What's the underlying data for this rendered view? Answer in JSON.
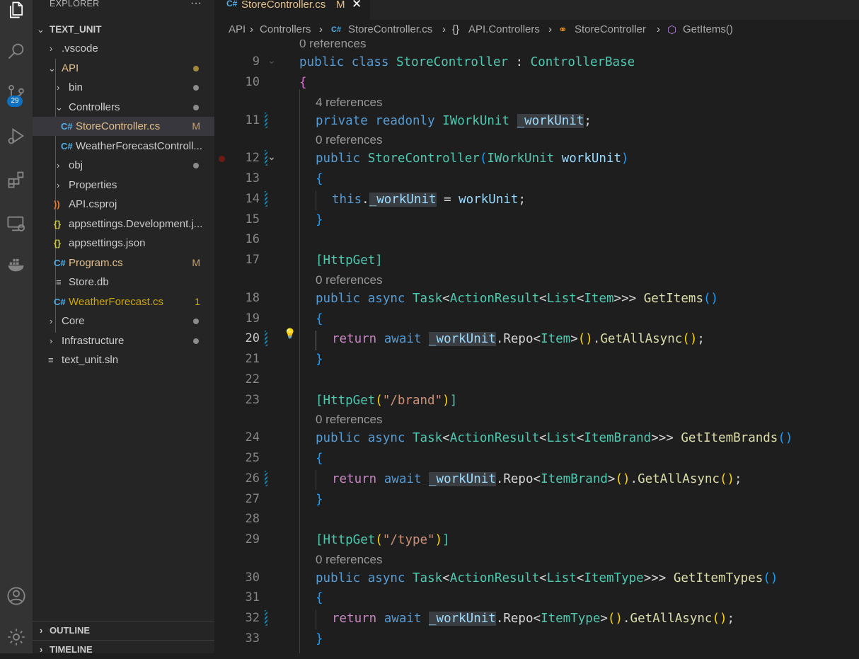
{
  "activity": {
    "badge": "29"
  },
  "explorer": {
    "header": "EXPLORER",
    "more": "···",
    "root": "TEXT_UNIT",
    "items": [
      {
        "label": ".vscode"
      },
      {
        "label": "API"
      },
      {
        "label": "bin"
      },
      {
        "label": "Controllers"
      },
      {
        "label": "StoreController.cs",
        "status": "M"
      },
      {
        "label": "WeatherForecastControll..."
      },
      {
        "label": "obj"
      },
      {
        "label": "Properties"
      },
      {
        "label": "API.csproj"
      },
      {
        "label": "appsettings.Development.j..."
      },
      {
        "label": "appsettings.json"
      },
      {
        "label": "Program.cs",
        "status": "M"
      },
      {
        "label": "Store.db"
      },
      {
        "label": "WeatherForecast.cs",
        "status": "1"
      },
      {
        "label": "Core"
      },
      {
        "label": "Infrastructure"
      },
      {
        "label": "text_unit.sln"
      }
    ],
    "outline": "OUTLINE",
    "timeline": "TIMELINE"
  },
  "tab": {
    "filename": "StoreController.cs",
    "status": "M",
    "close": "✕"
  },
  "breadcrumbs": [
    "API",
    "Controllers",
    "StoreController.cs",
    "API.Controllers",
    "StoreController",
    "GetItems()"
  ],
  "codelens": {
    "top": "0 references",
    "l11": "4 references",
    "l12": "0 references",
    "l18": "0 references",
    "l24": "0 references",
    "l30": "0 references"
  },
  "code": {
    "l9": {
      "public": "public",
      "class": "class",
      "name": "StoreController",
      "colon": " : ",
      "base": "ControllerBase"
    },
    "l10": "{",
    "l11": {
      "private": "private",
      "readonly": "readonly",
      "type": "IWorkUnit",
      "field": "_workUnit",
      "semi": ";"
    },
    "l12": {
      "public": "public",
      "name": "StoreController",
      "open": "(",
      "type": "IWorkUnit",
      "param": "workUnit",
      "close": ")"
    },
    "l13": "{",
    "l14": {
      "this": "this",
      "dot": ".",
      "field": "_workUnit",
      "assign": " = ",
      "val": "workUnit",
      "semi": ";"
    },
    "l15": "}",
    "l17": {
      "attr": "[HttpGet]"
    },
    "l18": {
      "public": "public",
      "async": "async",
      "task": "Task",
      "lt1": "<",
      "ar": "ActionResult",
      "lt2": "<",
      "list": "List",
      "lt3": "<",
      "item": "Item",
      "gt": ">>>",
      "method": "GetItems",
      "parens": "()"
    },
    "l19": "{",
    "l20": {
      "return": "return",
      "await": "await",
      "field": "_workUnit",
      "repo": ".Repo",
      "lt": "<",
      "type": "Item",
      "gt": ">",
      "call": "()",
      "dot": ".",
      "m": "GetAllAsync",
      "args": "()",
      "semi": ";"
    },
    "l21": "}",
    "l23": {
      "open": "[HttpGet",
      "p1": "(",
      "str": "\"/brand\"",
      "p2": ")",
      "close": "]"
    },
    "l24": {
      "public": "public",
      "async": "async",
      "task": "Task",
      "lt1": "<",
      "ar": "ActionResult",
      "lt2": "<",
      "list": "List",
      "lt3": "<",
      "item": "ItemBrand",
      "gt": ">>>",
      "method": "GetItemBrands",
      "parens": "()"
    },
    "l25": "{",
    "l26": {
      "return": "return",
      "await": "await",
      "field": "_workUnit",
      "repo": ".Repo",
      "lt": "<",
      "type": "ItemBrand",
      "gt": ">",
      "call": "()",
      "dot": ".",
      "m": "GetAllAsync",
      "args": "()",
      "semi": ";"
    },
    "l27": "}",
    "l29": {
      "open": "[HttpGet",
      "p1": "(",
      "str": "\"/type\"",
      "p2": ")",
      "close": "]"
    },
    "l30": {
      "public": "public",
      "async": "async",
      "task": "Task",
      "lt1": "<",
      "ar": "ActionResult",
      "lt2": "<",
      "list": "List",
      "lt3": "<",
      "item": "ItemType",
      "gt": ">>>",
      "method": "GetItemTypes",
      "parens": "()"
    },
    "l31": "{",
    "l32": {
      "return": "return",
      "await": "await",
      "field": "_workUnit",
      "repo": ".Repo",
      "lt": "<",
      "type": "ItemType",
      "gt": ">",
      "call": "()",
      "dot": ".",
      "m": "GetAllAsync",
      "args": "()",
      "semi": ";"
    },
    "l33": "}"
  },
  "line_numbers": [
    "9",
    "10",
    "11",
    "12",
    "13",
    "14",
    "15",
    "16",
    "17",
    "18",
    "19",
    "20",
    "21",
    "22",
    "23",
    "24",
    "25",
    "26",
    "27",
    "28",
    "29",
    "30",
    "31",
    "32",
    "33"
  ],
  "colors": {
    "keyword": "#569cd6",
    "control": "#c586c0",
    "type": "#4ec9b0",
    "function": "#dcdcaa",
    "variable": "#9cdcfe",
    "string": "#ce9178",
    "modified": "#e2c08d",
    "badge": "#0e70c0"
  }
}
